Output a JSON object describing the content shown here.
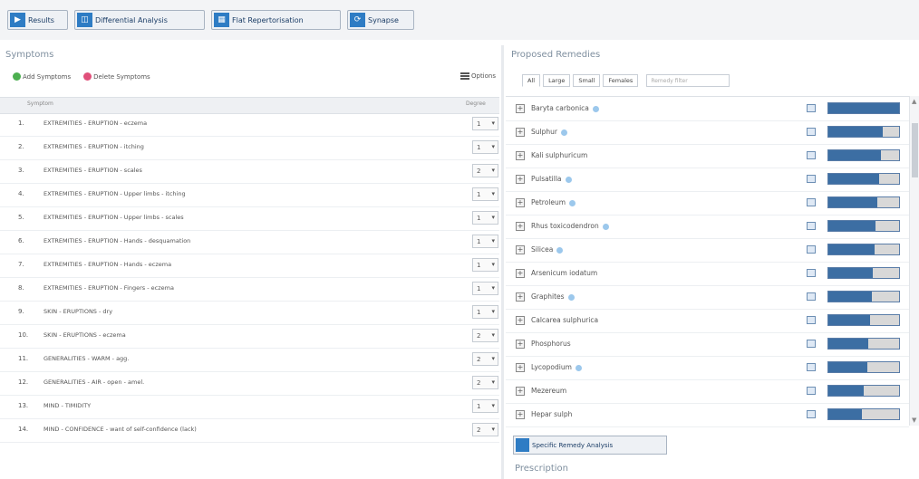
{
  "toolbar": {
    "buttons": [
      {
        "label": "Results",
        "icon": "play-icon"
      },
      {
        "label": "Differential Analysis",
        "icon": "analysis-icon"
      },
      {
        "label": "Flat Repertorisation",
        "icon": "grid-icon"
      },
      {
        "label": "Synapse",
        "icon": "synapse-icon"
      }
    ]
  },
  "symptoms": {
    "title": "Symptoms",
    "add_label": "Add Symptoms",
    "delete_label": "Delete Symptoms",
    "options_label": "Options",
    "col_symptom": "Symptom",
    "col_degree": "Degree",
    "rows": [
      {
        "num": "1.",
        "text": "EXTREMITIES - ERUPTION - eczema",
        "degree": "1"
      },
      {
        "num": "2.",
        "text": "EXTREMITIES - ERUPTION - itching",
        "degree": "1"
      },
      {
        "num": "3.",
        "text": "EXTREMITIES - ERUPTION - scales",
        "degree": "2"
      },
      {
        "num": "4.",
        "text": "EXTREMITIES - ERUPTION - Upper limbs - itching",
        "degree": "1"
      },
      {
        "num": "5.",
        "text": "EXTREMITIES - ERUPTION - Upper limbs - scales",
        "degree": "1"
      },
      {
        "num": "6.",
        "text": "EXTREMITIES - ERUPTION - Hands - desquamation",
        "degree": "1"
      },
      {
        "num": "7.",
        "text": "EXTREMITIES - ERUPTION - Hands - eczema",
        "degree": "1"
      },
      {
        "num": "8.",
        "text": "EXTREMITIES - ERUPTION - Fingers - eczema",
        "degree": "1"
      },
      {
        "num": "9.",
        "text": "SKIN - ERUPTIONS - dry",
        "degree": "1"
      },
      {
        "num": "10.",
        "text": "SKIN - ERUPTIONS - eczema",
        "degree": "2"
      },
      {
        "num": "11.",
        "text": "GENERALITIES - WARM - agg.",
        "degree": "2"
      },
      {
        "num": "12.",
        "text": "GENERALITIES - AIR - open - amel.",
        "degree": "2"
      },
      {
        "num": "13.",
        "text": "MIND - TIMIDITY",
        "degree": "1"
      },
      {
        "num": "14.",
        "text": "MIND - CONFIDENCE - want of self-confidence (lack)",
        "degree": "2"
      }
    ]
  },
  "remedies": {
    "title": "Proposed Remedies",
    "tabs": [
      "All",
      "Large",
      "Small",
      "Females"
    ],
    "filter_placeholder": "Remedy filter",
    "rows": [
      {
        "name": "Baryta carbonica",
        "info": true,
        "score": 1.0
      },
      {
        "name": "Sulphur",
        "info": true,
        "score": 0.77
      },
      {
        "name": "Kali sulphuricum",
        "info": false,
        "score": 0.74
      },
      {
        "name": "Pulsatilla",
        "info": true,
        "score": 0.72
      },
      {
        "name": "Petroleum",
        "info": true,
        "score": 0.69
      },
      {
        "name": "Rhus toxicodendron",
        "info": true,
        "score": 0.67
      },
      {
        "name": "Silicea",
        "info": true,
        "score": 0.65
      },
      {
        "name": "Arsenicum iodatum",
        "info": false,
        "score": 0.63
      },
      {
        "name": "Graphites",
        "info": true,
        "score": 0.61
      },
      {
        "name": "Calcarea sulphurica",
        "info": false,
        "score": 0.59
      },
      {
        "name": "Phosphorus",
        "info": false,
        "score": 0.57
      },
      {
        "name": "Lycopodium",
        "info": true,
        "score": 0.55
      },
      {
        "name": "Mezereum",
        "info": false,
        "score": 0.5
      },
      {
        "name": "Hepar sulph",
        "info": false,
        "score": 0.48
      }
    ],
    "analysis_button": "Specific Remedy Analysis",
    "prescription_title": "Prescription"
  },
  "colors": {
    "accent": "#2e7cc4",
    "bar_fill": "#3c6ea3",
    "add": "#4caf50",
    "delete": "#e0507a"
  }
}
